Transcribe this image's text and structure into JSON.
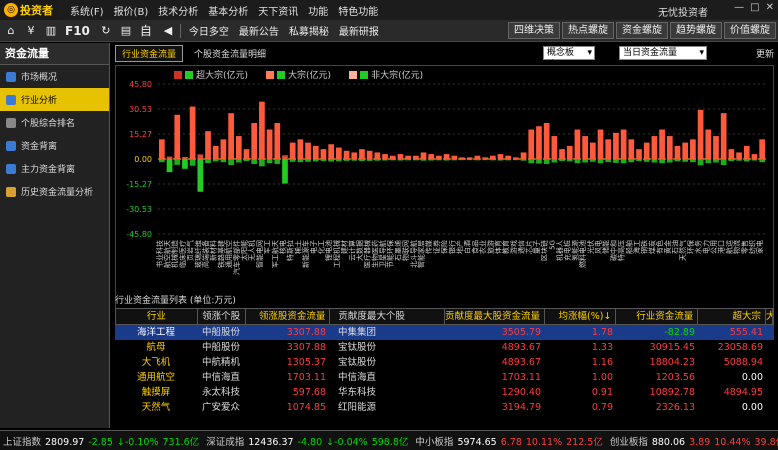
{
  "app": {
    "logo_text": "投资者",
    "user_label": "无忧投资者",
    "min": "—",
    "max": "□",
    "close": "✕"
  },
  "menu": [
    "系统(F)",
    "报价(B)",
    "技术分析",
    "基本分析",
    "天下资讯",
    "功能",
    "特色功能"
  ],
  "toolbar": {
    "f10": "F10",
    "auto": "自",
    "items": [
      "今日多空",
      "最新公告",
      "私募揭秘",
      "最新研报"
    ],
    "right_buttons": [
      "四维决策",
      "热点螺旋",
      "资金螺旋",
      "趋势螺旋",
      "价值螺旋"
    ]
  },
  "sidebar": {
    "title": "资金流量",
    "items": [
      "市场概况",
      "行业分析",
      "个股综合排名",
      "资金背离",
      "主力资金背离",
      "历史资金流量分析"
    ],
    "active_index": 1,
    "icon_colors": [
      "#3a7bd5",
      "#3a7bd5",
      "#888",
      "#3a7bd5",
      "#3a7bd5",
      "#d8a030"
    ]
  },
  "tabs": [
    "行业资金流量",
    "个股资金流量明细"
  ],
  "selects": {
    "board": "概念板块",
    "flow": "当日资金流量"
  },
  "refresh": "更新",
  "chart_data": {
    "type": "bar",
    "legend": [
      "超大宗(亿元)",
      "大宗(亿元)",
      "非大宗(亿元)"
    ],
    "colors": {
      "up": "#ff5a3c",
      "down": "#22cc22",
      "super_up": "#cc3322",
      "big_up": "#ff7b5a",
      "nonbig_up": "#ffae9a",
      "zero": "#ffd000"
    },
    "yticks": [
      "45.80",
      "30.53",
      "15.27",
      "0.00",
      "-15.27",
      "-30.53",
      "-45.80"
    ],
    "ylim": [
      -45.8,
      45.8
    ],
    "categories": [
      "书业科技",
      "航空航天",
      "机械制造",
      "临床医疗",
      "页岩气",
      "玻璃纤维",
      "高端装备",
      "新材料",
      "铁路基建",
      "通用航空",
      "汽车零部件",
      "太阳能",
      "无人机",
      "智能电网",
      "军工",
      "军工航天",
      "核电",
      "特斯拉",
      "稀土",
      "新能源车",
      "电子",
      "化工",
      "锂电池",
      "工程机械",
      "建材",
      "云计算",
      "大数据",
      "医疗器械",
      "生物医药",
      "卫星导航",
      "节能环保",
      "石墨烯",
      "物联网",
      "北斗导航",
      "智能家居",
      "传媒",
      "证券",
      "保险",
      "银行",
      "地产",
      "白酒",
      "食品",
      "农业",
      "旅游",
      "体育",
      "教育",
      "游戏",
      "通信",
      "芯片",
      "量子",
      "区块链",
      "5G",
      "机器人",
      "充电桩",
      "氢能源",
      "燃料电池",
      "光伏",
      "风电",
      "储能",
      "碳中和",
      "特高压",
      "船舶",
      "海工",
      "钢铁",
      "煤炭",
      "有色",
      "黄金",
      "石油",
      "天然气",
      "环保",
      "水务",
      "电力",
      "公用",
      "港口",
      "航运",
      "物流",
      "零售",
      "纺织",
      "家电"
    ],
    "values": [
      12,
      -8,
      27,
      -6,
      32,
      -20,
      17,
      8,
      12,
      28,
      14,
      6,
      22,
      35,
      18,
      22,
      -15,
      10,
      12,
      10,
      8,
      6,
      9,
      7,
      5,
      4,
      6,
      5,
      4,
      3,
      2,
      3,
      2,
      2,
      4,
      3,
      2,
      3,
      2,
      1,
      1,
      2,
      1,
      2,
      3,
      2,
      1,
      4,
      18,
      20,
      22,
      14,
      6,
      8,
      18,
      14,
      10,
      18,
      12,
      16,
      18,
      12,
      6,
      10,
      14,
      18,
      14,
      8,
      10,
      12,
      30,
      18,
      14,
      28,
      6,
      4,
      8,
      3,
      12
    ]
  },
  "table": {
    "title": "行业资金流量列表 (单位:万元)",
    "headers": [
      "行业",
      "领涨个股",
      "领涨股资金流量",
      "贡献度最大个股",
      "贡献度最大股资金流量",
      "均涨幅(%)↓",
      "行业资金流量",
      "超大宗",
      "大"
    ],
    "rows": [
      [
        "海洋工程",
        "中船股份",
        "3307.88",
        "中集集团",
        "3505.79",
        "1.78",
        "-82.89",
        "555.41"
      ],
      [
        "航母",
        "中船股份",
        "3307.88",
        "宝钛股份",
        "4893.67",
        "1.33",
        "30915.45",
        "23058.69"
      ],
      [
        "大飞机",
        "中航精机",
        "1305.37",
        "宝钛股份",
        "4893.67",
        "1.16",
        "18804.23",
        "5088.94"
      ],
      [
        "通用航空",
        "中信海直",
        "1703.11",
        "中信海直",
        "1703.11",
        "1.00",
        "1203.56",
        "0.00"
      ],
      [
        "触摸屏",
        "永太科技",
        "597.68",
        "华东科技",
        "1290.40",
        "0.91",
        "10892.78",
        "4894.95"
      ],
      [
        "天然气",
        "广安爱众",
        "1074.85",
        "红阳能源",
        "3194.79",
        "0.79",
        "2326.13",
        "0.00"
      ]
    ]
  },
  "status": [
    {
      "label": "上证指数",
      "values": [
        "2809.97",
        "-2.85",
        "↓-0.10%",
        "731.6亿"
      ],
      "color": "green"
    },
    {
      "label": "深证成指",
      "values": [
        "12436.37",
        "-4.80",
        "↓-0.04%",
        "598.8亿"
      ],
      "color": "green"
    },
    {
      "label": "中小板指",
      "values": [
        "5974.65",
        "6.78",
        "10.11%",
        "212.5亿"
      ],
      "color": "red"
    },
    {
      "label": "创业板指",
      "values": [
        "880.06",
        "3.89",
        "10.44%",
        "39.8亿"
      ],
      "color": "red"
    }
  ]
}
